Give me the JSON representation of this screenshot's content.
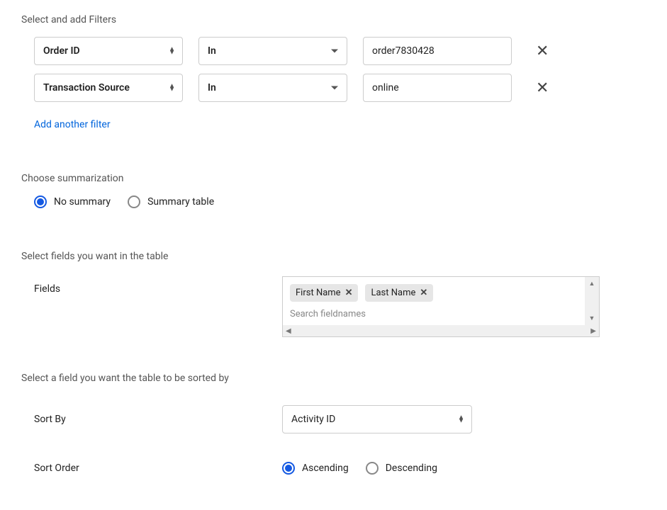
{
  "filters": {
    "heading": "Select and add Filters",
    "rows": [
      {
        "field": "Order ID",
        "operator": "In",
        "value": "order7830428"
      },
      {
        "field": "Transaction Source",
        "operator": "In",
        "value": "online"
      }
    ],
    "add_link": "Add another filter"
  },
  "summary": {
    "heading": "Choose summarization",
    "options": {
      "no_summary": "No summary",
      "summary_table": "Summary table"
    },
    "selected": "no_summary"
  },
  "fields": {
    "heading": "Select fields you want in the table",
    "label": "Fields",
    "chips": [
      "First Name",
      "Last Name"
    ],
    "placeholder": "Search fieldnames"
  },
  "sort": {
    "heading": "Select a field you want the table to be sorted by",
    "by_label": "Sort By",
    "by_value": "Activity ID",
    "order_label": "Sort Order",
    "order_options": {
      "asc": "Ascending",
      "desc": "Descending"
    },
    "order_selected": "asc"
  }
}
